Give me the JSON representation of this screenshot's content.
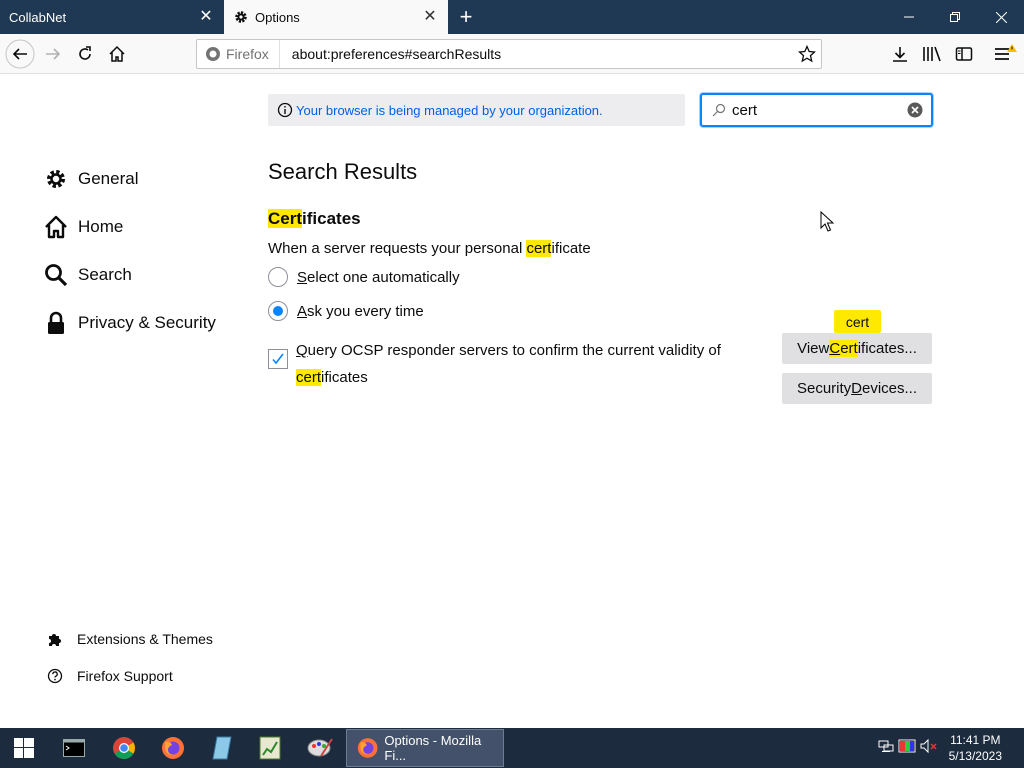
{
  "tabs": [
    {
      "label": "CollabNet",
      "active": false
    },
    {
      "label": "Options",
      "active": true
    }
  ],
  "urlbar": {
    "identity_label": "Firefox",
    "url": "about:preferences#searchResults"
  },
  "policy_notice": "Your browser is being managed by your organization.",
  "search": {
    "value": "cert"
  },
  "sidebar": {
    "items": [
      {
        "label": "General",
        "icon": "gear-icon"
      },
      {
        "label": "Home",
        "icon": "home-icon"
      },
      {
        "label": "Search",
        "icon": "search-icon"
      },
      {
        "label": "Privacy & Security",
        "icon": "lock-icon"
      }
    ],
    "footer": [
      {
        "label": "Extensions & Themes",
        "icon": "puzzle-icon"
      },
      {
        "label": "Firefox Support",
        "icon": "help-icon"
      }
    ]
  },
  "main": {
    "heading": "Search Results",
    "section_title_hl": "Cert",
    "section_title_rest": "ificates",
    "description_pre": "When a server requests your personal ",
    "description_hl": "cert",
    "description_post": "ificate",
    "radio_auto_ul": "S",
    "radio_auto_rest": "elect one automatically",
    "radio_auto_checked": false,
    "radio_ask_ul": "A",
    "radio_ask_rest": "sk you every time",
    "radio_ask_checked": true,
    "ocsp_ul": "Q",
    "ocsp_rest": "uery OCSP responder servers to confirm the current validity of",
    "ocsp_hl": "cert",
    "ocsp_post": "ificates",
    "ocsp_checked": true,
    "view_cert_pre": "View ",
    "view_cert_hl_ul": "C",
    "view_cert_hl": "ert",
    "view_cert_post": "ificates...",
    "security_devices_pre": "Security ",
    "security_devices_ul": "D",
    "security_devices_post": "evices...",
    "tooltip": "cert"
  },
  "taskbar": {
    "active_window": "Options - Mozilla Fi...",
    "time": "11:41 PM",
    "date": "5/13/2023"
  },
  "colors": {
    "accent": "#0a84ff",
    "highlight": "#ffe900",
    "titlebar": "#1f3853",
    "taskbar": "#1c2b3d"
  }
}
